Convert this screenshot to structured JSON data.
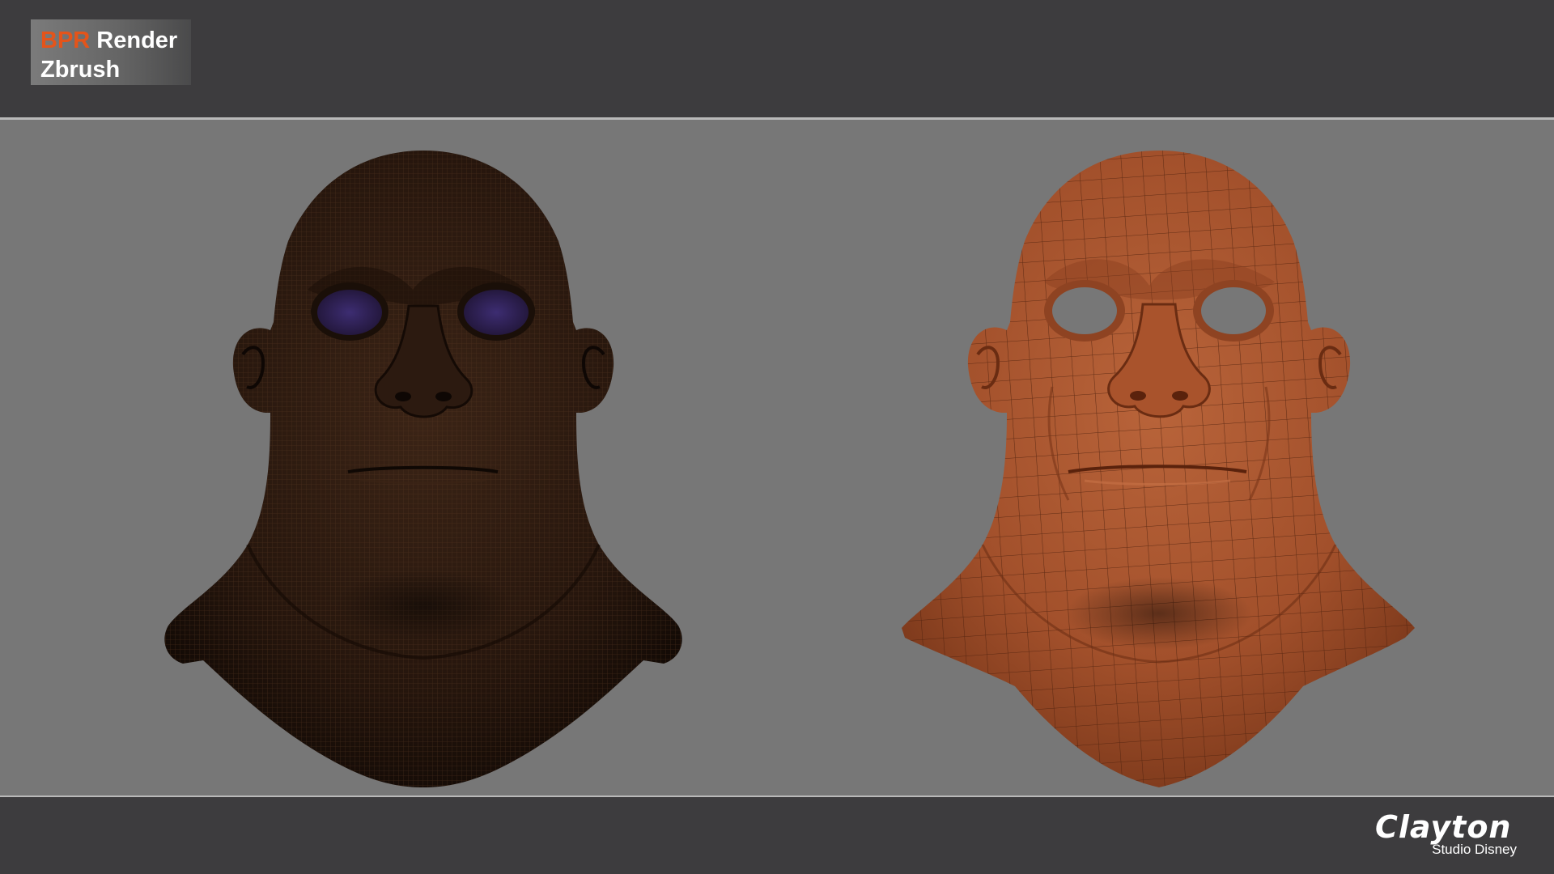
{
  "header": {
    "title_accent": "BPR",
    "title_rest": " Render",
    "subtitle": "Zbrush"
  },
  "viewport": {
    "left_model": "dark-wireframe-head-render",
    "right_model": "clay-wireframe-head-render",
    "colors": {
      "frame": "#3d3c3e",
      "stage": "#777777",
      "accent": "#e4541a",
      "dark_skin": "#3a2314",
      "clay_skin": "#a8552e",
      "eye_glow": "#3a2a6a"
    }
  },
  "footer": {
    "logo_name": "Clayton",
    "logo_tagline": "Studio Disney"
  }
}
